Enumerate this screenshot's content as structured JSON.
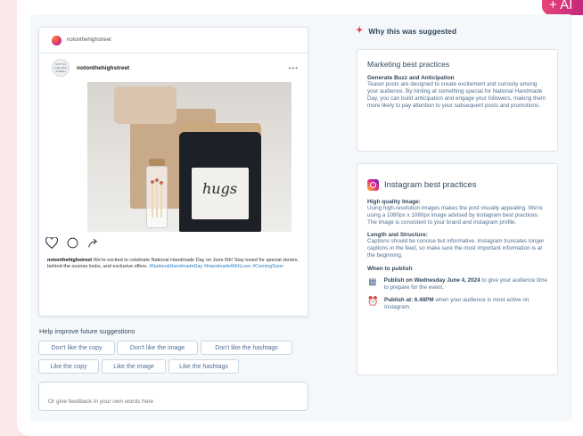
{
  "corner": {
    "text": "+ AI"
  },
  "post": {
    "account_top": "notonthehighstreet",
    "avatar_text": "NOT ON THE HIGH STREET",
    "username": "notonthehighstreet",
    "more": "•••",
    "image_label": "hugs",
    "caption_user": "notonthehighstreet",
    "caption_text": " We're excited to celebrate National Handmade Day on June 5th! Stay tuned for special stories, behind-the-scenes looks, and exclusive offers. ",
    "caption_tags": "#NationalHandmadeDay #HandmadeWithLove #ComingSoon"
  },
  "feedback": {
    "title": "Help improve future suggestions",
    "chips": [
      "Don't like the copy",
      "Don't like the image",
      "Don't like the hashtags",
      "Like the copy",
      "Like the image",
      "Like the hashtags"
    ],
    "placeholder": "Or give feedback in your own words here"
  },
  "why": {
    "title": "Why this was suggested"
  },
  "marketing": {
    "title": "Marketing best practices",
    "subtitle": "Generate Buzz and Anticipation",
    "body": "Teaser posts are designed to create excitement and curiosity among your audience. By hinting at something special for National Handmade Day, you can build anticipation and engage your followers, making them more likely to pay attention to your subsequent posts and promotions."
  },
  "instagram": {
    "title": "Instagram best practices",
    "q_title": "High quality Image:",
    "q_body": "Using high-resolution images makes the post visually appealing. We're using a 1080px x 1080px image advised by instagram best practices. The image is consistent to your brand and instagram profile.",
    "l_title": "Length and Structure:",
    "l_body": "Captions should be concise but informative. Instagram truncates longer captions in the feed, so make sure the most important information is at the beginning.",
    "when_title": "When to publish",
    "pub1_bold": "Publish on Wednesday June 4, 2024",
    "pub1_rest": " to give your audience time to prepare for the event.",
    "pub2_bold": "Publish at: 6.48PM",
    "pub2_rest": " when your audience is most active on Instagram."
  },
  "icons": [
    "instagram-icon",
    "heart-icon",
    "comment-icon",
    "share-icon",
    "sparkle-icon",
    "calendar-icon",
    "clock-icon"
  ],
  "colors": {
    "accent": "#e0425f",
    "hashtag": "#2d7ec4",
    "text": "#33475b"
  }
}
